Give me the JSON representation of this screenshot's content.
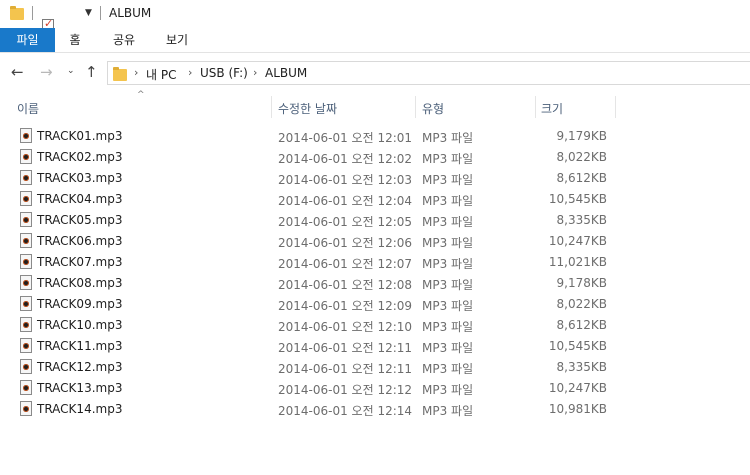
{
  "window": {
    "title": "ALBUM"
  },
  "ribbon": {
    "tabs": [
      "파일",
      "홈",
      "공유",
      "보기"
    ]
  },
  "address": {
    "crumbs": [
      "내 PC",
      "USB (F:)",
      "ALBUM"
    ]
  },
  "columns": {
    "name": "이름",
    "date": "수정한 날짜",
    "type": "유형",
    "size": "크기"
  },
  "files": [
    {
      "name": "TRACK01.mp3",
      "date": "2014-06-01 오전 12:01",
      "type": "MP3 파일",
      "size": "9,179KB"
    },
    {
      "name": "TRACK02.mp3",
      "date": "2014-06-01 오전 12:02",
      "type": "MP3 파일",
      "size": "8,022KB"
    },
    {
      "name": "TRACK03.mp3",
      "date": "2014-06-01 오전 12:03",
      "type": "MP3 파일",
      "size": "8,612KB"
    },
    {
      "name": "TRACK04.mp3",
      "date": "2014-06-01 오전 12:04",
      "type": "MP3 파일",
      "size": "10,545KB"
    },
    {
      "name": "TRACK05.mp3",
      "date": "2014-06-01 오전 12:05",
      "type": "MP3 파일",
      "size": "8,335KB"
    },
    {
      "name": "TRACK06.mp3",
      "date": "2014-06-01 오전 12:06",
      "type": "MP3 파일",
      "size": "10,247KB"
    },
    {
      "name": "TRACK07.mp3",
      "date": "2014-06-01 오전 12:07",
      "type": "MP3 파일",
      "size": "11,021KB"
    },
    {
      "name": "TRACK08.mp3",
      "date": "2014-06-01 오전 12:08",
      "type": "MP3 파일",
      "size": "9,178KB"
    },
    {
      "name": "TRACK09.mp3",
      "date": "2014-06-01 오전 12:09",
      "type": "MP3 파일",
      "size": "8,022KB"
    },
    {
      "name": "TRACK10.mp3",
      "date": "2014-06-01 오전 12:10",
      "type": "MP3 파일",
      "size": "8,612KB"
    },
    {
      "name": "TRACK11.mp3",
      "date": "2014-06-01 오전 12:11",
      "type": "MP3 파일",
      "size": "10,545KB"
    },
    {
      "name": "TRACK12.mp3",
      "date": "2014-06-01 오전 12:11",
      "type": "MP3 파일",
      "size": "8,335KB"
    },
    {
      "name": "TRACK13.mp3",
      "date": "2014-06-01 오전 12:12",
      "type": "MP3 파일",
      "size": "10,247KB"
    },
    {
      "name": "TRACK14.mp3",
      "date": "2014-06-01 오전 12:14",
      "type": "MP3 파일",
      "size": "10,981KB"
    }
  ],
  "colors": {
    "file_tab": "#1979ca",
    "header_text": "#4c607a",
    "folder": "#f4c44e"
  }
}
